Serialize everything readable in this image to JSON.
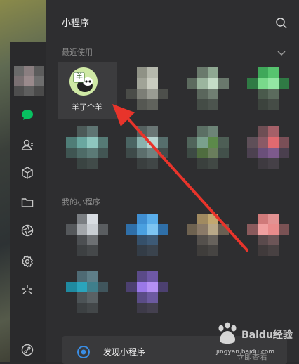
{
  "panel": {
    "title": "小程序"
  },
  "sections": {
    "recent": "最近使用",
    "mine": "我的小程序"
  },
  "featured_app": {
    "name": "羊了个羊",
    "icon_glyph": "羊"
  },
  "discover": {
    "label": "发现小程序",
    "action": "立即查看"
  },
  "watermark": {
    "brand": "Baidu经验",
    "url": "jingyan.baidu.com"
  },
  "colors": {
    "accent_green": "#07c160",
    "annotation_red": "#e8342b",
    "panel_bg": "#2e2e30"
  },
  "icons": [
    "search-icon",
    "chevron-down-icon",
    "chat-icon",
    "contacts-icon",
    "cube-icon",
    "folder-icon",
    "aperture-icon",
    "gear-icon",
    "sparkle-icon",
    "link-icon"
  ]
}
